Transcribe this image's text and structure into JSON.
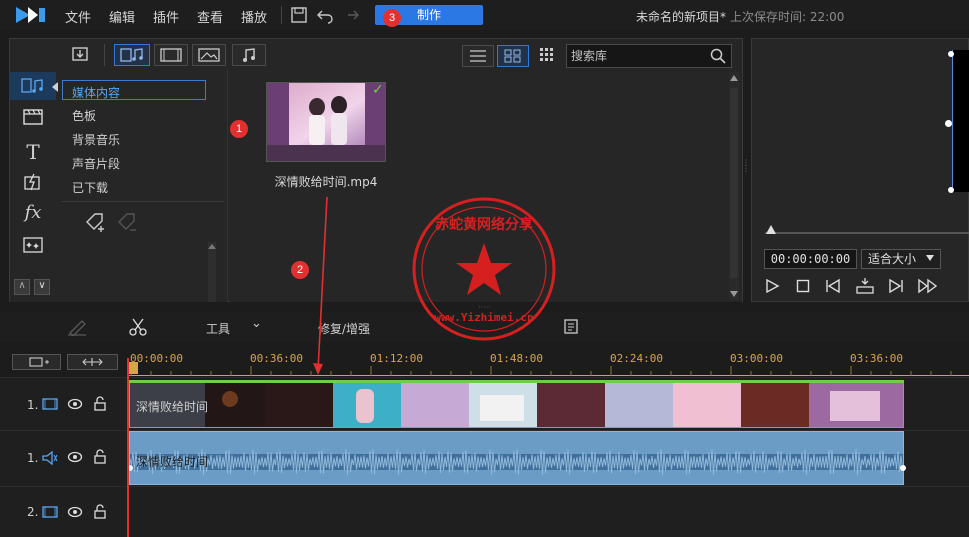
{
  "menubar": {
    "items": [
      "文件",
      "编辑",
      "插件",
      "查看",
      "播放"
    ],
    "produce_label": "制作",
    "project_title": "未命名的新项目*",
    "saved_time": "上次保存时间: 22:00"
  },
  "callouts": [
    "1",
    "2",
    "3"
  ],
  "library": {
    "search_placeholder": "搜索库",
    "categories": [
      "媒体内容",
      "色板",
      "背景音乐",
      "声音片段",
      "已下载"
    ],
    "media_items": [
      {
        "filename": "深情败给时间.mp4"
      }
    ]
  },
  "preview": {
    "timecode": "00:00:00:00",
    "fit_option": "适合大小"
  },
  "timeline_tools": {
    "tools_label": "工具",
    "fix_label": "修复/增强"
  },
  "ruler": {
    "ticks": [
      "00:00:00",
      "00:36:00",
      "01:12:00",
      "01:48:00",
      "02:24:00",
      "03:00:00",
      "03:36:00"
    ]
  },
  "tracks": [
    {
      "number": "1.",
      "type": "video",
      "clip_label": "深情败给时间"
    },
    {
      "number": "1.",
      "type": "audio",
      "clip_label": "深情败给时间"
    },
    {
      "number": "2.",
      "type": "video",
      "clip_label": ""
    }
  ],
  "watermark": {
    "text": "赤蛇黄网络分享",
    "url": "www.Yizhimei.cn"
  },
  "colors": {
    "accent": "#2b78e4",
    "callout": "#e1302f",
    "ruler": "#d8a645",
    "audio_clip": "#6a9cc5"
  }
}
